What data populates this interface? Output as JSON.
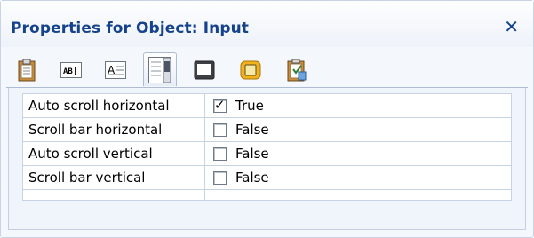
{
  "window": {
    "title": "Properties for Object: Input",
    "close_glyph": "✕"
  },
  "toolbar": {
    "tools": [
      {
        "name": "clipboard-icon"
      },
      {
        "name": "text-field-icon",
        "text": "AB|"
      },
      {
        "name": "label-text-icon",
        "text": "A"
      },
      {
        "name": "scrollbars-icon",
        "active": true
      },
      {
        "name": "border-style-icon"
      },
      {
        "name": "background-color-icon"
      },
      {
        "name": "checklist-icon"
      }
    ]
  },
  "properties": [
    {
      "name": "Auto scroll horizontal",
      "value": "True",
      "checked": true
    },
    {
      "name": "Scroll bar horizontal",
      "value": "False",
      "checked": false
    },
    {
      "name": "Auto scroll vertical",
      "value": "False",
      "checked": false
    },
    {
      "name": "Scroll bar vertical",
      "value": "False",
      "checked": false
    }
  ],
  "colors": {
    "title": "#15428b",
    "grid_border": "#c8d4e6",
    "panel_bg": "#f4f7fc"
  }
}
